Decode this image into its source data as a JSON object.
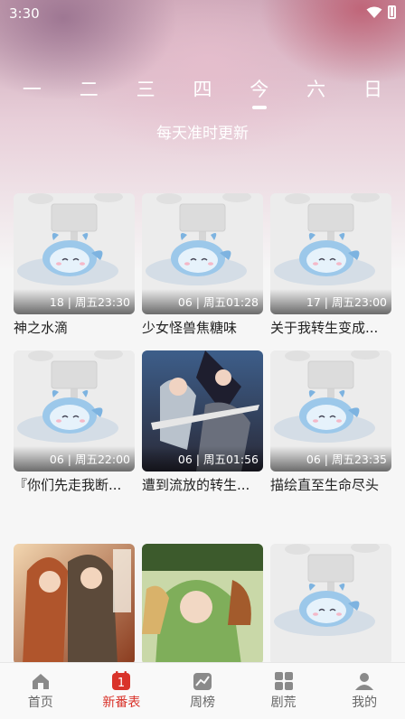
{
  "status": {
    "time": "3:30"
  },
  "week": {
    "days": [
      "一",
      "二",
      "三",
      "四",
      "今",
      "六",
      "日"
    ],
    "active_index": 4,
    "subtitle": "每天准时更新"
  },
  "cards": [
    {
      "title": "神之水滴",
      "episode": "18 | 周五23:30",
      "cover": "placeholder"
    },
    {
      "title": "少女怪兽焦糖味",
      "episode": "06 | 周五01:28",
      "cover": "placeholder"
    },
    {
      "title": "关于我转生变成...",
      "episode": "17 | 周五23:00",
      "cover": "placeholder"
    },
    {
      "title": "『你们先走我断...",
      "episode": "06 | 周五22:00",
      "cover": "placeholder"
    },
    {
      "title": "遭到流放的转生...",
      "episode": "06 | 周五01:56",
      "cover": "art-dark"
    },
    {
      "title": "描绘直至生命尽头",
      "episode": "06 | 周五23:35",
      "cover": "placeholder"
    },
    {
      "title": "",
      "episode": "",
      "cover": "art-warm"
    },
    {
      "title": "",
      "episode": "",
      "cover": "art-green"
    },
    {
      "title": "",
      "episode": "",
      "cover": "placeholder"
    }
  ],
  "tabbar": {
    "items": [
      {
        "label": "首页",
        "icon": "home-icon"
      },
      {
        "label": "新番表",
        "icon": "calendar-icon",
        "badge": "1"
      },
      {
        "label": "周榜",
        "icon": "chart-icon"
      },
      {
        "label": "剧荒",
        "icon": "grid-icon"
      },
      {
        "label": "我的",
        "icon": "person-icon"
      }
    ],
    "active_index": 1
  },
  "colors": {
    "accent": "#d9332a",
    "placeholder_bg": "#ececec",
    "mascot": "#9cc8ea"
  }
}
